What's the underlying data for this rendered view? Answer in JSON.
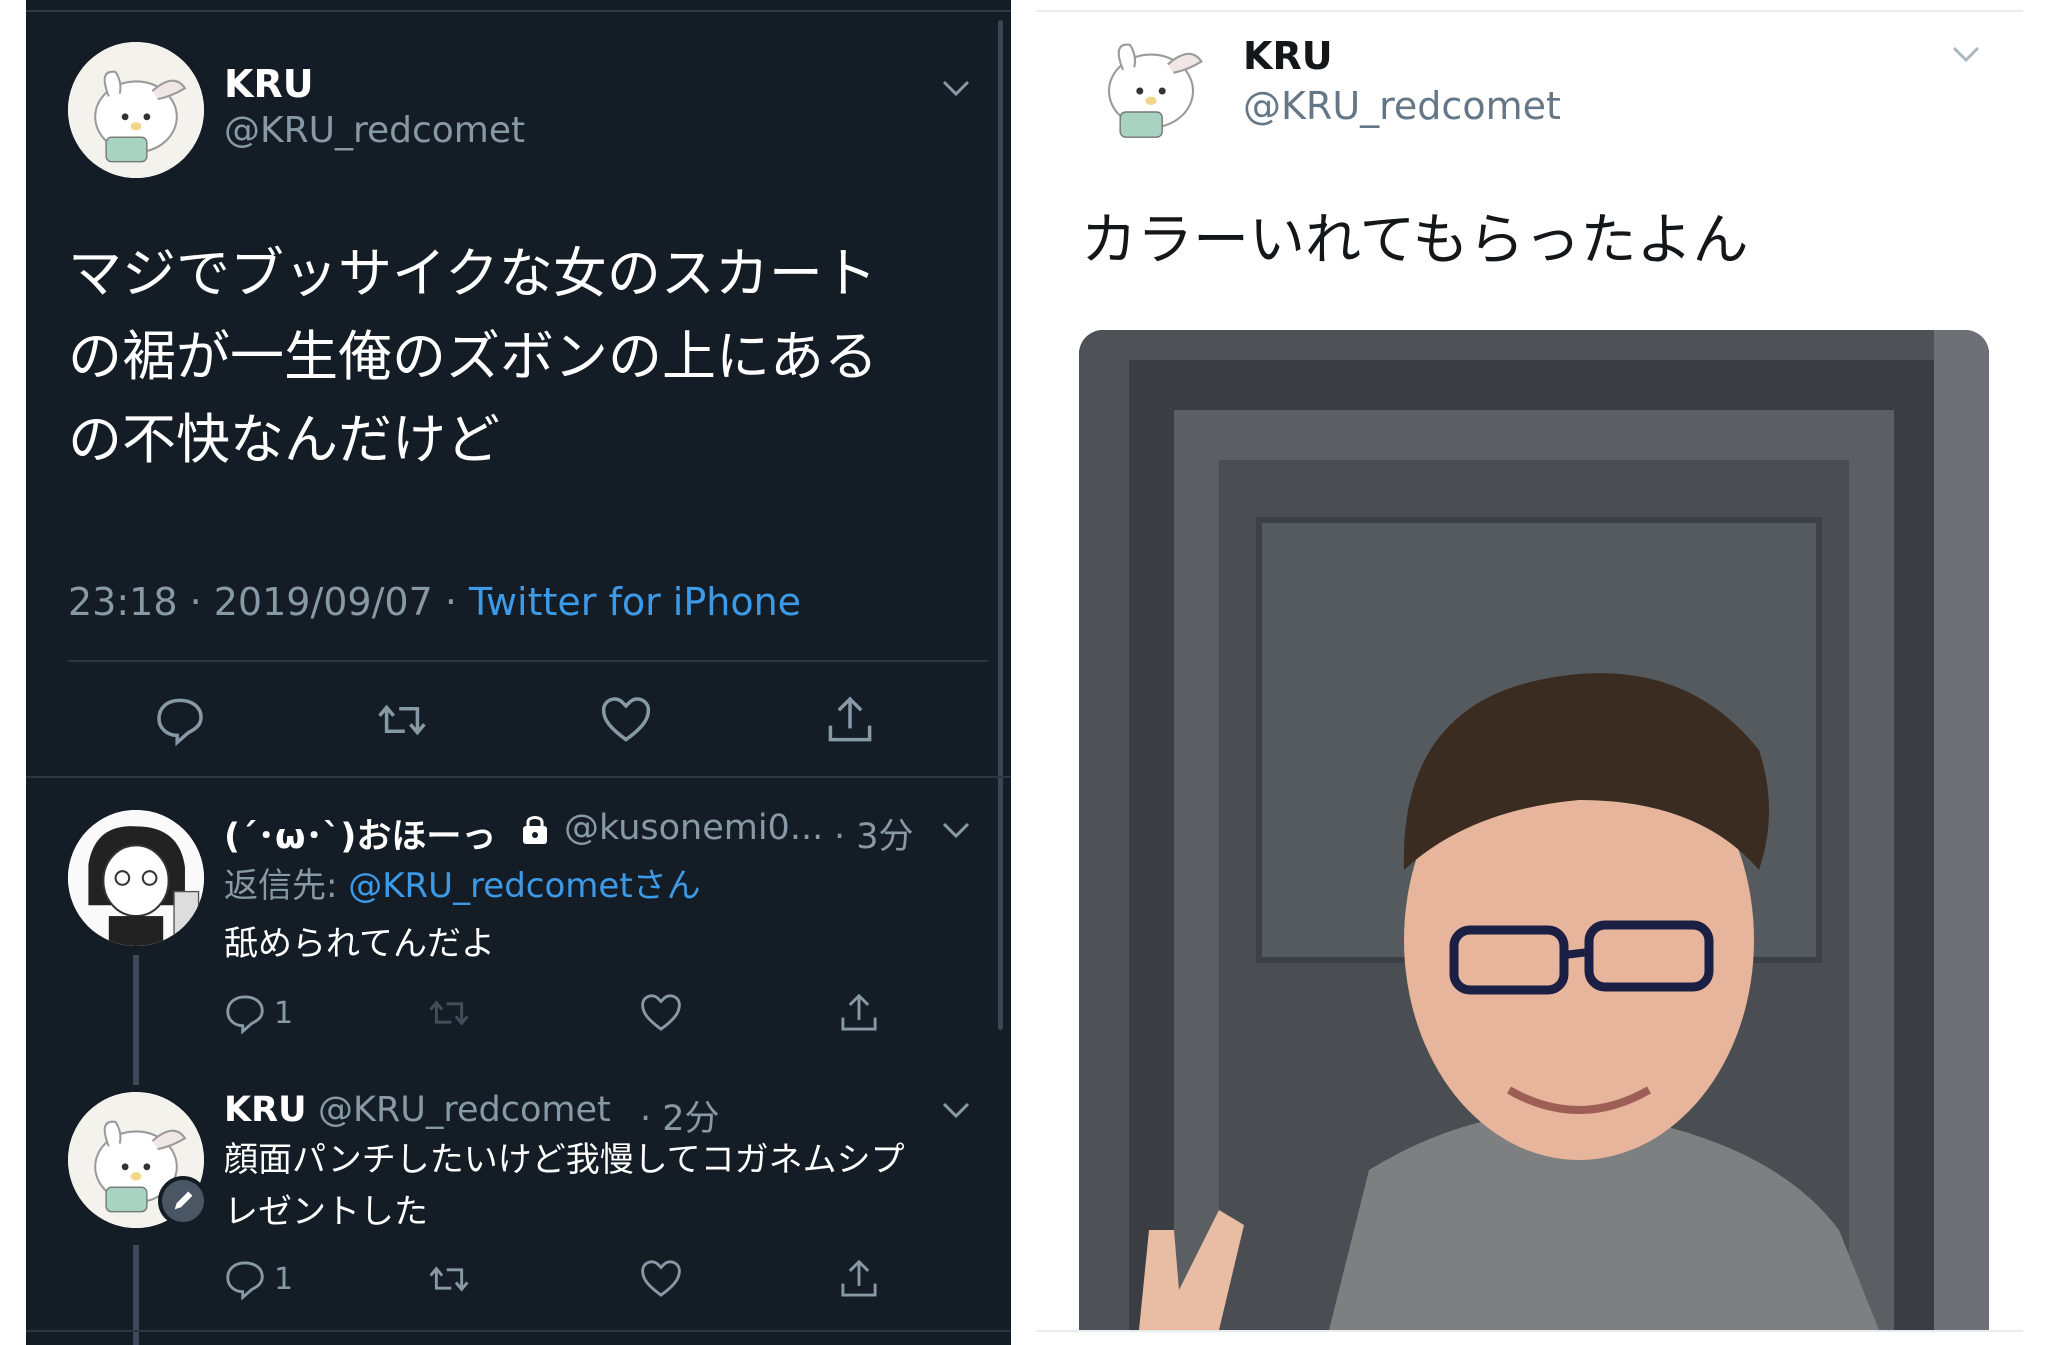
{
  "left": {
    "main_tweet": {
      "name": "KRU",
      "handle": "@KRU_redcomet",
      "lines": [
        "マジでブッサイクな女のスカート",
        "の裾が一生俺のズボンの上にある",
        "の不快なんだけど"
      ],
      "timestamp": "23:18 · 2019/09/07 · ",
      "source": "Twitter for iPhone"
    },
    "reply1": {
      "name": "(´･ω･`)おほーっ",
      "handle": "@kusonemi0...",
      "time": "· 3分",
      "reply_to_label": "返信先: ",
      "reply_to_handle": "@KRU_redcometさん",
      "text": "舐められてんだよ",
      "reply_count": "1"
    },
    "reply2": {
      "name": "KRU",
      "handle": "@KRU_redcomet",
      "time": "· 2分",
      "lines": [
        "顔面パンチしたいけど我慢してコガネムシプ",
        "レゼントした"
      ],
      "reply_count": "1"
    }
  },
  "right": {
    "name": "KRU",
    "handle": "@KRU_redcomet",
    "text": "カラーいれてもらったよん"
  },
  "icons": [
    "chevron-down-icon",
    "reply-icon",
    "retweet-icon",
    "like-icon",
    "share-icon",
    "lock-icon",
    "pencil-badge-icon"
  ],
  "colors": {
    "dark_bg": "#141d26",
    "link_blue": "#3c9ae7",
    "muted_text": "#8899a6"
  }
}
